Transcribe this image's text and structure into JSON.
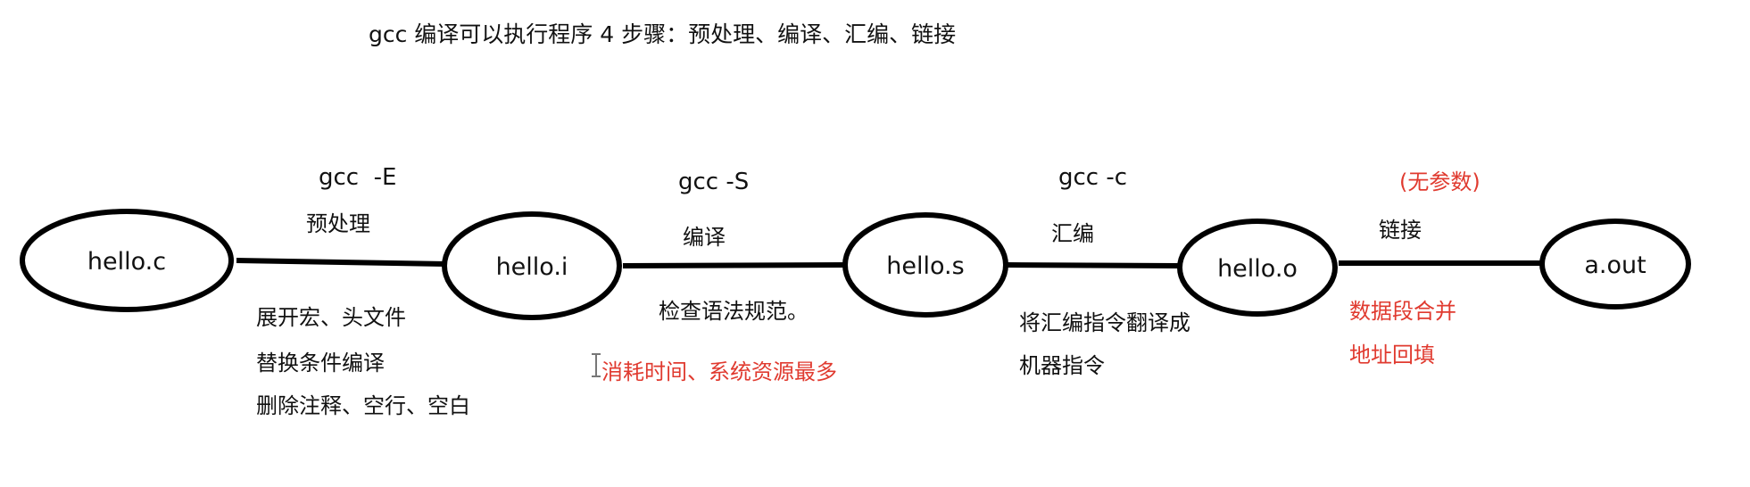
{
  "title": "gcc 编译可以执行程序  4 步骤：预处理、编译、汇编、链接",
  "nodes": [
    {
      "id": "hello-c",
      "label": "hello.c"
    },
    {
      "id": "hello-i",
      "label": "hello.i"
    },
    {
      "id": "hello-s",
      "label": "hello.s"
    },
    {
      "id": "hello-o",
      "label": "hello.o"
    },
    {
      "id": "a-out",
      "label": "a.out"
    }
  ],
  "steps": [
    {
      "command": "gcc  -E",
      "name": "预处理",
      "notes": [
        "展开宏、头文件",
        "替换条件编译",
        "删除注释、空行、空白"
      ]
    },
    {
      "command": "gcc -S",
      "name": "编译",
      "notes": [
        "检查语法规范。"
      ],
      "highlight": "消耗时间、系统资源最多"
    },
    {
      "command": "gcc -c",
      "name": "汇编",
      "notes": [
        "将汇编指令翻译成",
        "机器指令"
      ]
    },
    {
      "param_note": "(无参数)",
      "name": "链接",
      "red_notes": [
        "数据段合并",
        "地址回填"
      ]
    }
  ],
  "colors": {
    "text": "#111111",
    "accent": "#e03a2f",
    "line": "#000000"
  }
}
